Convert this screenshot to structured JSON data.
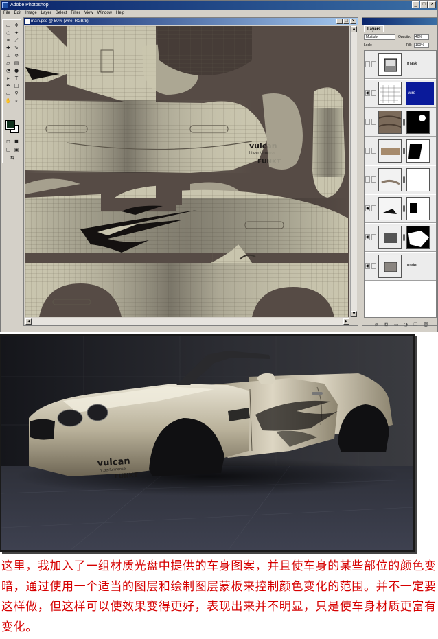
{
  "app": {
    "title": "Adobe Photoshop",
    "menus": [
      "File",
      "Edit",
      "Image",
      "Layer",
      "Select",
      "Filter",
      "View",
      "Window",
      "Help"
    ]
  },
  "document": {
    "title": "main.psd @ 50% (wire, RGB/8)",
    "texture_text": {
      "brand": "vulcan",
      "tagline": "hi.performance",
      "maker": "FUNKT"
    }
  },
  "layers_panel": {
    "tab": "Layers",
    "blend_mode": "Multiply",
    "opacity_label": "Opacity:",
    "opacity": "40%",
    "lock_label": "Lock:",
    "fill_label": "Fill:",
    "fill": "100%",
    "layers": [
      {
        "name": "mask",
        "visible": false,
        "selected": false
      },
      {
        "name": "wire",
        "visible": true,
        "selected": true
      },
      {
        "name": "",
        "visible": false,
        "selected": false
      },
      {
        "name": "",
        "visible": false,
        "selected": false
      },
      {
        "name": "",
        "visible": false,
        "selected": false
      },
      {
        "name": "",
        "visible": true,
        "selected": false
      },
      {
        "name": "",
        "visible": true,
        "selected": false
      },
      {
        "name": "under",
        "visible": true,
        "selected": false
      }
    ]
  },
  "render": {
    "decal_brand": "vulcan",
    "decal_tagline": "hi.performance",
    "decal_maker": "FUNKT"
  },
  "caption": "这里，我加入了一组材质光盘中提供的车身图案，并且使车身的某些部位的颜色变暗，通过使用一个适当的图层和绘制图层蒙板来控制颜色变化的范围。并不一定要这样做，但这样可以使效果变得更好，表现出来并不明显，只是使车身材质更富有变化。",
  "colors": {
    "canvas_bg": "#564b45",
    "texture_cream": "#c9c5ae",
    "selection_blue": "#0a1a9a",
    "caption_red": "#d60000"
  }
}
